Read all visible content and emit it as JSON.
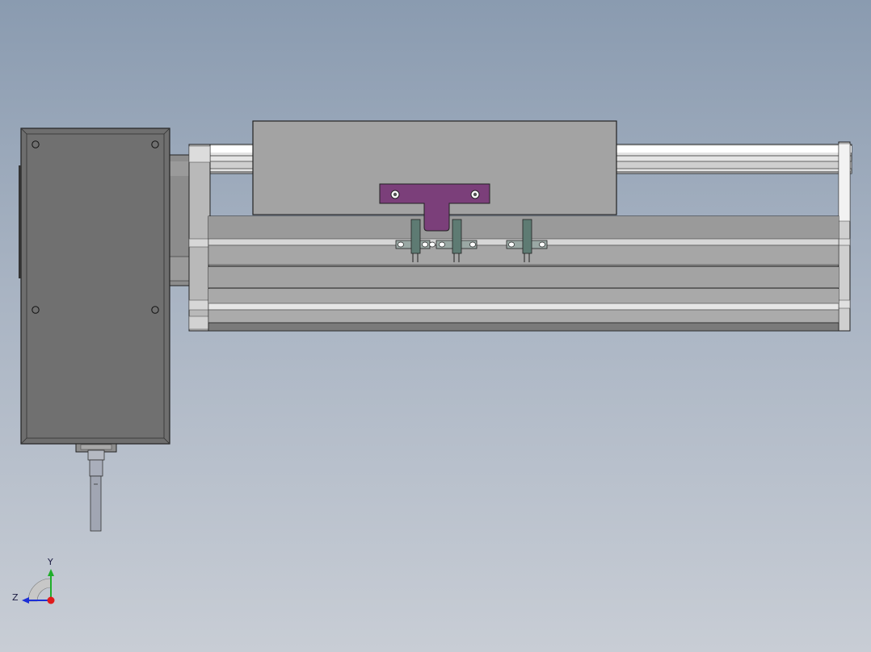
{
  "viewport": {
    "background_top": "#8a9bb0",
    "background_bottom": "#c8cdd5"
  },
  "model": {
    "motor_color": "#6e6e6e",
    "carriage_color": "#a3a3a3",
    "bracket_color": "#7b3f7a",
    "sensor_color": "#5e7b73",
    "rail_color": "#c8c8c8"
  },
  "triad": {
    "y_label": "Y",
    "z_label": "Z",
    "y_color": "#1fae2a",
    "z_color": "#1c2fd6",
    "x_color": "#e01b1b",
    "icon": "coordinate-triad-icon"
  }
}
